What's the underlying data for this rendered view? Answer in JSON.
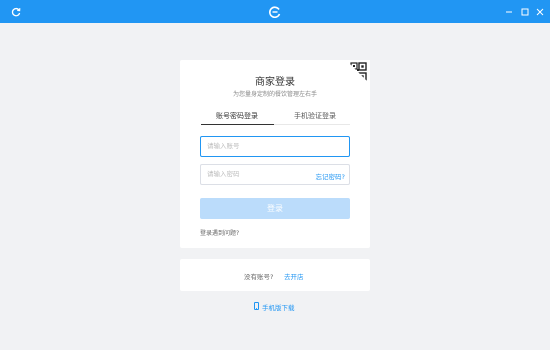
{
  "colors": {
    "accent": "#2196f3",
    "title_bar": "#2196f3",
    "button_disabled": "#bbdcfb",
    "background": "#f1f2f4"
  },
  "titlebar": {
    "left_icon": "refresh-icon",
    "logo_icon": "app-logo-icon",
    "controls": [
      "minimize-icon",
      "maximize-icon",
      "close-icon"
    ]
  },
  "login": {
    "title": "商家登录",
    "subtitle": "为您量身定制的餐饮管理左右手",
    "qr_icon": "qrcode-icon",
    "tabs": [
      {
        "label": "账号密码登录",
        "active": true
      },
      {
        "label": "手机验证登录",
        "active": false
      }
    ],
    "account_placeholder": "请输入账号",
    "password_placeholder": "请输入密码",
    "forgot_label": "忘记密码?",
    "login_label": "登录",
    "problem_label": "登录遇到问题?"
  },
  "register": {
    "no_account_label": "没有账号?",
    "open_store_label": "去开店"
  },
  "mobile_download": {
    "icon": "phone-icon",
    "label": "手机版下载"
  }
}
